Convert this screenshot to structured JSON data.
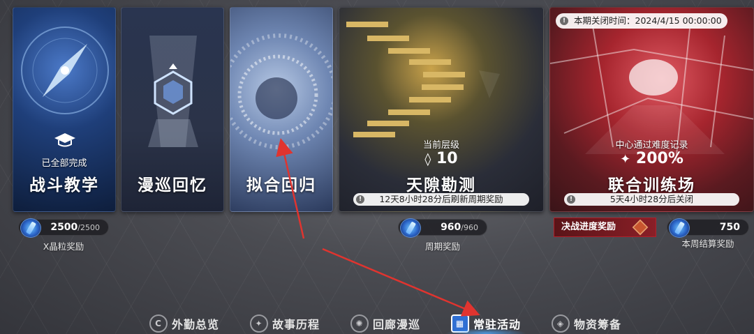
{
  "cards": {
    "battle_teaching": {
      "status": "已全部完成",
      "title": "战斗教学"
    },
    "roaming_memory": {
      "title": "漫巡回忆"
    },
    "fitting_return": {
      "title": "拟合回归"
    },
    "rift_survey": {
      "level_label": "当前层级",
      "level_value": "10",
      "title": "天隙勘测",
      "timer": "12天8小时28分后刷新周期奖励"
    },
    "joint_training": {
      "close_time": "本期关闭时间：2024/4/15 00:00:00",
      "record_label": "中心通过难度记录",
      "record_value": "200%",
      "title": "联合训练场",
      "timer": "5天4小时28分后关闭"
    }
  },
  "rewards": {
    "crystal": {
      "value": "2500",
      "max": "/2500",
      "label": "X晶粒奖励"
    },
    "cycle": {
      "value": "960",
      "max": "/960",
      "label": "周期奖励"
    },
    "battle_progress": {
      "label": "决战进度奖励"
    },
    "weekly": {
      "value": "750",
      "label": "本周结算奖励"
    }
  },
  "nav": {
    "items": [
      {
        "label": "外勤总览",
        "icon": "c-badge-icon"
      },
      {
        "label": "故事历程",
        "icon": "star-compass-icon"
      },
      {
        "label": "回廊漫巡",
        "icon": "swirl-icon"
      },
      {
        "label": "常驻活动",
        "icon": "calendar-icon"
      },
      {
        "label": "物资筹备",
        "icon": "cube-icon"
      }
    ],
    "active_index": 3
  },
  "colors": {
    "accent_blue": "#2f6fd3",
    "alert_red": "#b0202b",
    "arrow_red": "#e0342f"
  }
}
